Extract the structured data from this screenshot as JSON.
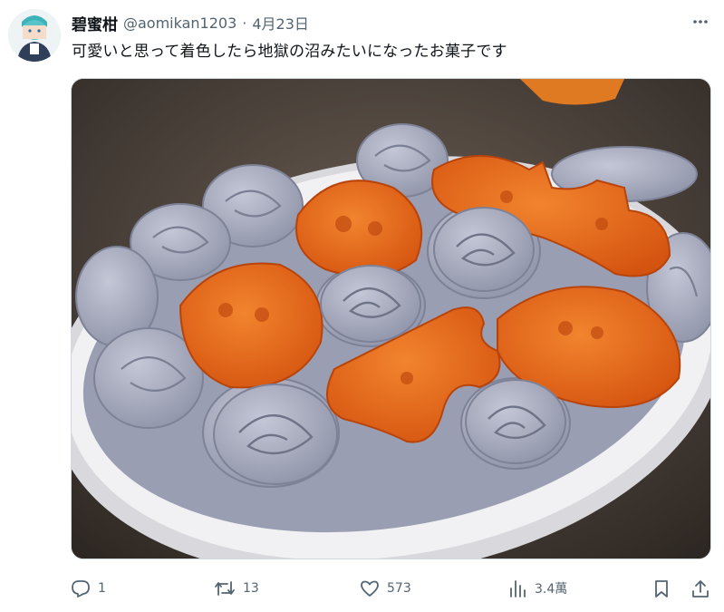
{
  "tweet": {
    "display_name": "碧蜜柑",
    "handle": "@aomikan1203",
    "separator": "·",
    "date": "4月23日",
    "text": "可愛いと思って着色したら地獄の沼みたいになったお菓子です"
  },
  "media": {
    "icon": "photo-image",
    "colors": {
      "cream": "#a6aabd",
      "cookie": "#e8641c",
      "plate": "#f1f0f3"
    }
  },
  "actions": {
    "reply_count": "1",
    "retweet_count": "13",
    "like_count": "573",
    "view_count": "3.4萬"
  },
  "icons": {
    "reply": "reply-icon",
    "retweet": "retweet-icon",
    "like": "heart-icon",
    "views": "views-icon",
    "bookmark": "bookmark-icon",
    "share": "share-icon",
    "more": "more-icon"
  },
  "theme": {
    "text": "#0f1419",
    "muted": "#536471",
    "border": "#cfd9de"
  }
}
